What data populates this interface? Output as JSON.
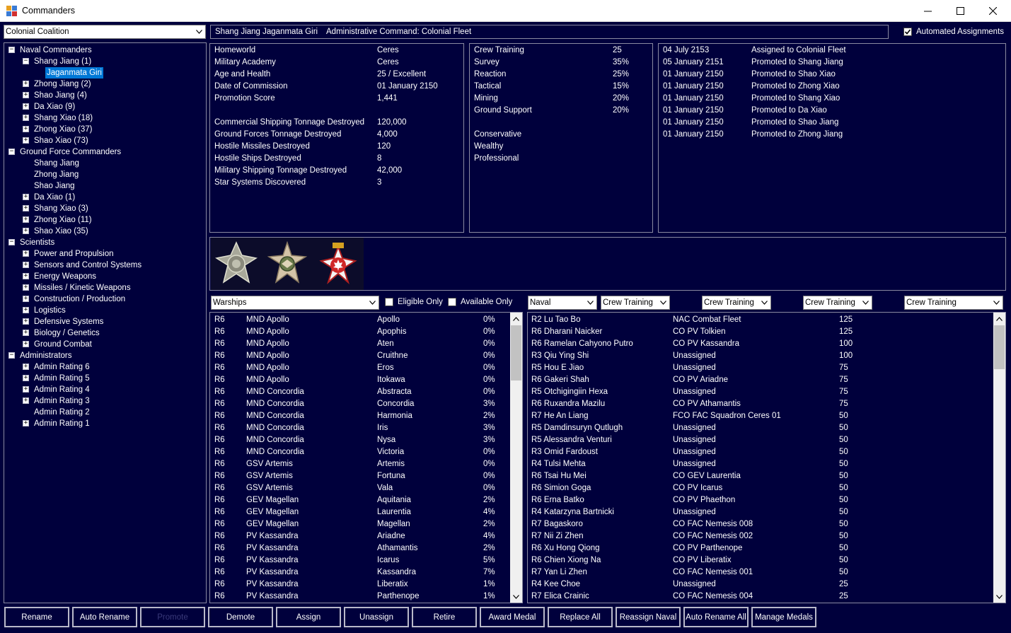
{
  "window": {
    "title": "Commanders",
    "minimize_icon": "minimize-icon",
    "maximize_icon": "maximize-icon",
    "close_icon": "close-icon"
  },
  "race_select": {
    "value": "Colonial Coalition"
  },
  "header": {
    "commander_name": "Shang Jiang Jaganmata Giri",
    "command_label": "Administrative Command:  Colonial Fleet"
  },
  "automated_assignments": {
    "label": "Automated Assignments",
    "checked": true
  },
  "tree": [
    {
      "label": "Naval Commanders",
      "level": 0,
      "expander": "-"
    },
    {
      "label": "Shang Jiang (1)",
      "level": 1,
      "expander": "-"
    },
    {
      "label": "Jaganmata Giri",
      "level": 2,
      "expander": "",
      "selected": true
    },
    {
      "label": "Zhong Jiang (2)",
      "level": 1,
      "expander": "+"
    },
    {
      "label": "Shao Jiang (4)",
      "level": 1,
      "expander": "+"
    },
    {
      "label": "Da Xiao (9)",
      "level": 1,
      "expander": "+"
    },
    {
      "label": "Shang Xiao (18)",
      "level": 1,
      "expander": "+"
    },
    {
      "label": "Zhong Xiao (37)",
      "level": 1,
      "expander": "+"
    },
    {
      "label": "Shao Xiao (73)",
      "level": 1,
      "expander": "+"
    },
    {
      "label": "Ground Force Commanders",
      "level": 0,
      "expander": "-"
    },
    {
      "label": "Shang Jiang",
      "level": 1,
      "expander": ""
    },
    {
      "label": "Zhong Jiang",
      "level": 1,
      "expander": ""
    },
    {
      "label": "Shao Jiang",
      "level": 1,
      "expander": ""
    },
    {
      "label": "Da Xiao (1)",
      "level": 1,
      "expander": "+"
    },
    {
      "label": "Shang Xiao (3)",
      "level": 1,
      "expander": "+"
    },
    {
      "label": "Zhong Xiao (11)",
      "level": 1,
      "expander": "+"
    },
    {
      "label": "Shao Xiao (35)",
      "level": 1,
      "expander": "+"
    },
    {
      "label": "Scientists",
      "level": 0,
      "expander": "-"
    },
    {
      "label": "Power and Propulsion",
      "level": 1,
      "expander": "+"
    },
    {
      "label": "Sensors and Control Systems",
      "level": 1,
      "expander": "+"
    },
    {
      "label": "Energy Weapons",
      "level": 1,
      "expander": "+"
    },
    {
      "label": "Missiles / Kinetic Weapons",
      "level": 1,
      "expander": "+"
    },
    {
      "label": "Construction / Production",
      "level": 1,
      "expander": "+"
    },
    {
      "label": "Logistics",
      "level": 1,
      "expander": "+"
    },
    {
      "label": "Defensive Systems",
      "level": 1,
      "expander": "+"
    },
    {
      "label": "Biology / Genetics",
      "level": 1,
      "expander": "+"
    },
    {
      "label": "Ground Combat",
      "level": 1,
      "expander": "+"
    },
    {
      "label": "Administrators",
      "level": 0,
      "expander": "-"
    },
    {
      "label": "Admin Rating 6",
      "level": 1,
      "expander": "+"
    },
    {
      "label": "Admin Rating 5",
      "level": 1,
      "expander": "+"
    },
    {
      "label": "Admin Rating 4",
      "level": 1,
      "expander": "+"
    },
    {
      "label": "Admin Rating 3",
      "level": 1,
      "expander": "+"
    },
    {
      "label": "Admin Rating 2",
      "level": 1,
      "expander": ""
    },
    {
      "label": "Admin Rating 1",
      "level": 1,
      "expander": "+"
    }
  ],
  "info": [
    [
      "Homeworld",
      "Ceres"
    ],
    [
      "Military Academy",
      "Ceres"
    ],
    [
      "Age and Health",
      "25 / Excellent"
    ],
    [
      "Date of Commission",
      "01 January 2150"
    ],
    [
      "Promotion Score",
      "1,441"
    ],
    [
      "",
      ""
    ],
    [
      "Commercial Shipping Tonnage Destroyed",
      "120,000"
    ],
    [
      "Ground Forces Tonnage Destroyed",
      "4,000"
    ],
    [
      "Hostile Missiles Destroyed",
      "120"
    ],
    [
      "Hostile Ships Destroyed",
      "8"
    ],
    [
      "Military Shipping Tonnage Destroyed",
      "42,000"
    ],
    [
      "Star Systems Discovered",
      "3"
    ]
  ],
  "skills": [
    [
      "Crew Training",
      "25"
    ],
    [
      "Survey",
      "35%"
    ],
    [
      "Reaction",
      "25%"
    ],
    [
      "Tactical",
      "15%"
    ],
    [
      "Mining",
      "20%"
    ],
    [
      "Ground Support",
      "20%"
    ],
    [
      "",
      ""
    ],
    [
      "Conservative",
      ""
    ],
    [
      "Wealthy",
      ""
    ],
    [
      "Professional",
      ""
    ]
  ],
  "history": [
    [
      "04 July 2153",
      "Assigned to Colonial Fleet"
    ],
    [
      "05 January 2151",
      "Promoted to Shang Jiang"
    ],
    [
      "01 January 2150",
      "Promoted to Shao Xiao"
    ],
    [
      "01 January 2150",
      "Promoted to Zhong Xiao"
    ],
    [
      "01 January 2150",
      "Promoted to Shang Xiao"
    ],
    [
      "01 January 2150",
      "Promoted to Da Xiao"
    ],
    [
      "01 January 2150",
      "Promoted to Shao Jiang"
    ],
    [
      "01 January 2150",
      "Promoted to Zhong Jiang"
    ]
  ],
  "medals": [
    "cross-medal-icon",
    "eagle-cross-medal-icon",
    "maple-leaf-medal-icon"
  ],
  "ships_filter": {
    "type_select": "Warships",
    "eligible_only": {
      "label": "Eligible Only",
      "checked": false
    },
    "available_only": {
      "label": "Available Only",
      "checked": false
    }
  },
  "ships": [
    [
      "R6",
      "MND Apollo",
      "Apollo",
      "0%"
    ],
    [
      "R6",
      "MND Apollo",
      "Apophis",
      "0%"
    ],
    [
      "R6",
      "MND Apollo",
      "Aten",
      "0%"
    ],
    [
      "R6",
      "MND Apollo",
      "Cruithne",
      "0%"
    ],
    [
      "R6",
      "MND Apollo",
      "Eros",
      "0%"
    ],
    [
      "R6",
      "MND Apollo",
      "Itokawa",
      "0%"
    ],
    [
      "R6",
      "MND Concordia",
      "Abstracta",
      "0%"
    ],
    [
      "R6",
      "MND Concordia",
      "Concordia",
      "3%"
    ],
    [
      "R6",
      "MND Concordia",
      "Harmonia",
      "2%"
    ],
    [
      "R6",
      "MND Concordia",
      "Iris",
      "3%"
    ],
    [
      "R6",
      "MND Concordia",
      "Nysa",
      "3%"
    ],
    [
      "R6",
      "MND Concordia",
      "Victoria",
      "0%"
    ],
    [
      "R6",
      "GSV Artemis",
      "Artemis",
      "0%"
    ],
    [
      "R6",
      "GSV Artemis",
      "Fortuna",
      "0%"
    ],
    [
      "R6",
      "GSV Artemis",
      "Vala",
      "0%"
    ],
    [
      "R6",
      "GEV Magellan",
      "Aquitania",
      "2%"
    ],
    [
      "R6",
      "GEV Magellan",
      "Laurentia",
      "4%"
    ],
    [
      "R6",
      "GEV Magellan",
      "Magellan",
      "2%"
    ],
    [
      "R6",
      "PV Kassandra",
      "Ariadne",
      "4%"
    ],
    [
      "R6",
      "PV Kassandra",
      "Athamantis",
      "2%"
    ],
    [
      "R6",
      "PV Kassandra",
      "Icarus",
      "5%"
    ],
    [
      "R6",
      "PV Kassandra",
      "Kassandra",
      "7%"
    ],
    [
      "R6",
      "PV Kassandra",
      "Liberatix",
      "1%"
    ],
    [
      "R6",
      "PV Kassandra",
      "Parthenope",
      "1%"
    ]
  ],
  "officer_filters": [
    "Naval",
    "Crew Training",
    "Crew Training",
    "Crew Training",
    "Crew Training"
  ],
  "officers": [
    [
      "R2 Lu Tao Bo",
      "NAC Combat Fleet",
      "125"
    ],
    [
      "R6 Dharani Naicker",
      "CO PV Tolkien",
      "125"
    ],
    [
      "R6 Ramelan Cahyono Putro",
      "CO PV Kassandra",
      "100"
    ],
    [
      "R3 Qiu Ying Shi",
      "Unassigned",
      "100"
    ],
    [
      "R5 Hou E Jiao",
      "Unassigned",
      "75"
    ],
    [
      "R6 Gakeri Shah",
      "CO PV Ariadne",
      "75"
    ],
    [
      "R5 Otchigingiin Hexa",
      "Unassigned",
      "75"
    ],
    [
      "R6 Ruxandra Mazilu",
      "CO PV Athamantis",
      "75"
    ],
    [
      "R7 He An Liang",
      "FCO FAC Squadron Ceres 01",
      "50"
    ],
    [
      "R5 Damdinsuryn Qutlugh",
      "Unassigned",
      "50"
    ],
    [
      "R5 Alessandra Venturi",
      "Unassigned",
      "50"
    ],
    [
      "R3 Omid Fardoust",
      "Unassigned",
      "50"
    ],
    [
      "R4 Tulsi Mehta",
      "Unassigned",
      "50"
    ],
    [
      "R6 Tsai Hu Mei",
      "CO GEV Laurentia",
      "50"
    ],
    [
      "R6 Simion Goga",
      "CO PV Icarus",
      "50"
    ],
    [
      "R6 Erna Batko",
      "CO PV Phaethon",
      "50"
    ],
    [
      "R4 Katarzyna Bartnicki",
      "Unassigned",
      "50"
    ],
    [
      "R7 Bagaskoro",
      "CO FAC Nemesis 008",
      "50"
    ],
    [
      "R7 Nii Zi Zhen",
      "CO FAC Nemesis 002",
      "50"
    ],
    [
      "R6 Xu Hong Qiong",
      "CO PV Parthenope",
      "50"
    ],
    [
      "R6 Chien Xiong Na",
      "CO PV Liberatix",
      "50"
    ],
    [
      "R7 Yan Li Zhen",
      "CO FAC Nemesis 001",
      "50"
    ],
    [
      "R4 Kee Choe",
      "Unassigned",
      "25"
    ],
    [
      "R7 Elica Crainic",
      "CO FAC Nemesis 004",
      "25"
    ]
  ],
  "buttons": [
    {
      "label": "Rename",
      "disabled": false
    },
    {
      "label": "Auto Rename",
      "disabled": false
    },
    {
      "label": "Promote",
      "disabled": true
    },
    {
      "label": "Demote",
      "disabled": false
    },
    {
      "label": "Assign",
      "disabled": false
    },
    {
      "label": "Unassign",
      "disabled": false
    },
    {
      "label": "Retire",
      "disabled": false
    },
    {
      "label": "Award Medal",
      "disabled": false
    },
    {
      "label": "Replace All",
      "disabled": false
    },
    {
      "label": "Reassign Naval",
      "disabled": false
    },
    {
      "label": "Auto Rename All",
      "disabled": false
    },
    {
      "label": "Manage Medals",
      "disabled": false
    }
  ]
}
